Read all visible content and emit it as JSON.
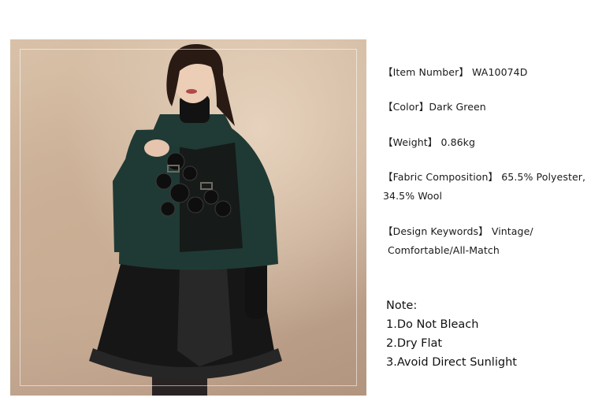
{
  "specs": {
    "item_number_label": "【Item Number】",
    "item_number": "WA10074D",
    "color_label": "【Color】",
    "color": "Dark Green",
    "weight_label": "【Weight】",
    "weight": "0.86kg",
    "fabric_label": "【Fabric Composition】",
    "fabric_line1": "65.5% Polyester,",
    "fabric_line2": "34.5% Wool",
    "design_label": "【Design Keywords】",
    "design_line1": "Vintage/",
    "design_line2": "Comfortable/All-Match"
  },
  "note": {
    "title": "Note:",
    "items": [
      "1.Do Not Bleach",
      "2.Dry Flat",
      "3.Avoid Direct Sunlight"
    ]
  },
  "colors": {
    "coat": "#1f3a35",
    "skirt": "#151515",
    "background": "#cdb39a"
  }
}
